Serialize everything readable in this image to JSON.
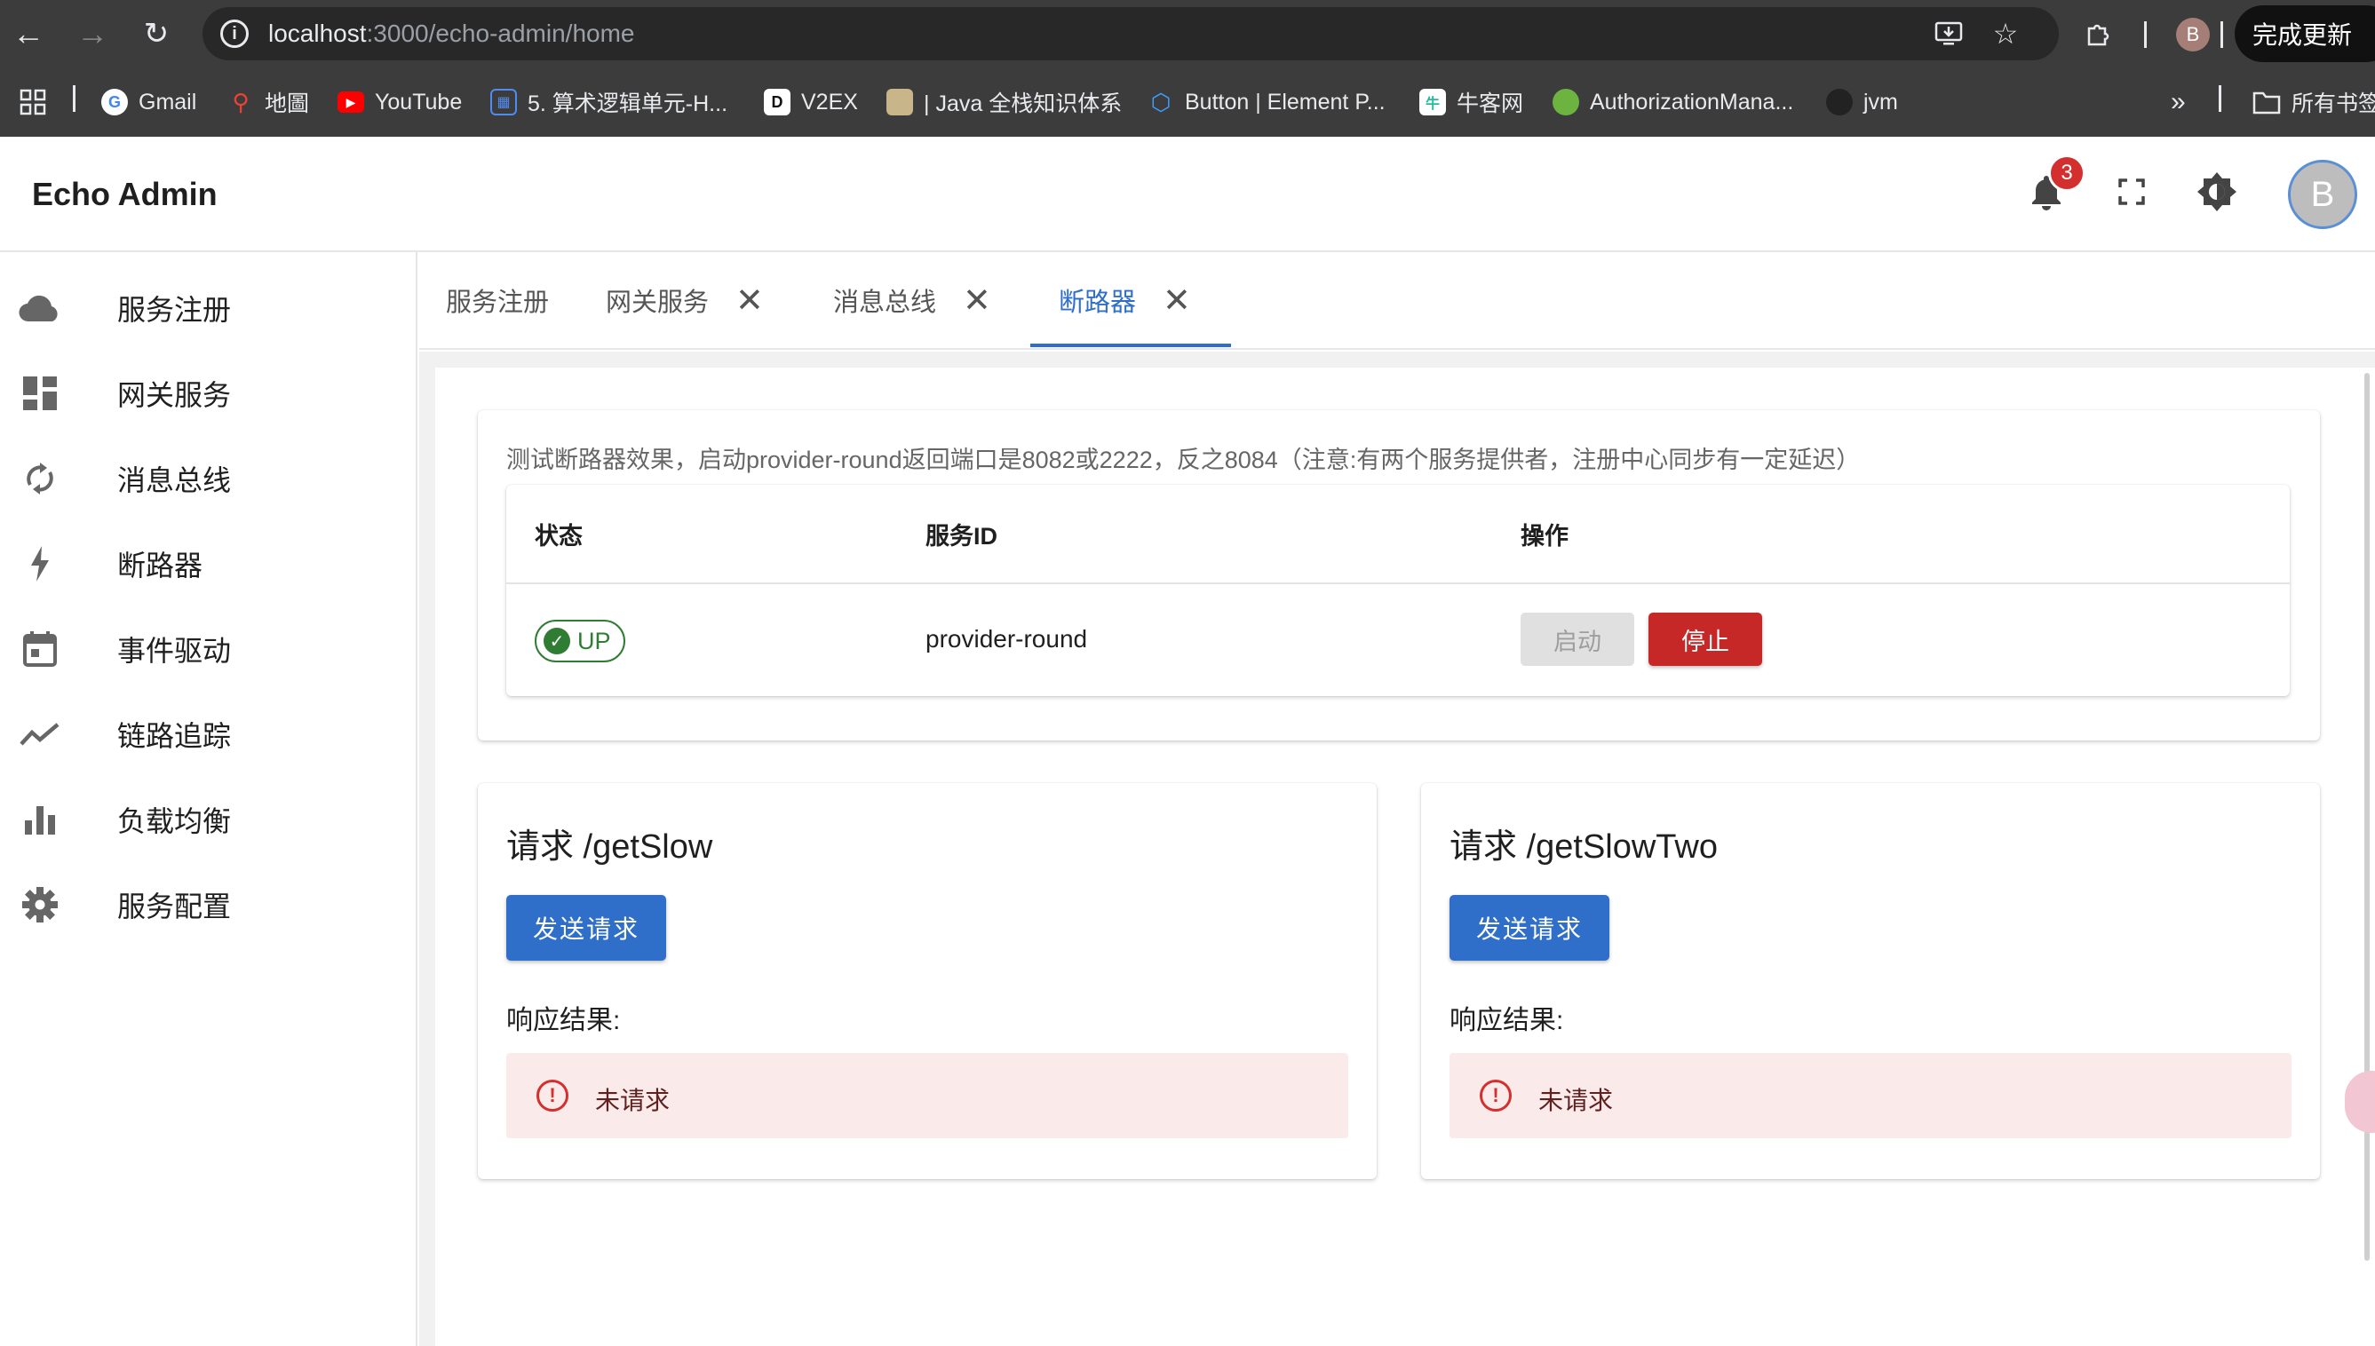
{
  "browser": {
    "url_host": "localhost",
    "url_rest": ":3000/echo-admin/home",
    "update_label": "完成更新",
    "profile_initial": "B",
    "all_bookmarks": "所有书签",
    "bookmarks": [
      {
        "label": "Gmail"
      },
      {
        "label": "地圖"
      },
      {
        "label": "YouTube"
      },
      {
        "label": "5. 算术逻辑单元-H..."
      },
      {
        "label": "V2EX"
      },
      {
        "label": "| Java 全栈知识体系"
      },
      {
        "label": "Button | Element P..."
      },
      {
        "label": "牛客网"
      },
      {
        "label": "AuthorizationMana..."
      },
      {
        "label": "jvm"
      }
    ]
  },
  "header": {
    "title": "Echo Admin",
    "notification_count": "3",
    "avatar_initial": "B"
  },
  "sidebar": {
    "items": [
      {
        "label": "服务注册",
        "icon": "cloud-icon"
      },
      {
        "label": "网关服务",
        "icon": "dashboard-icon"
      },
      {
        "label": "消息总线",
        "icon": "sync-icon"
      },
      {
        "label": "断路器",
        "icon": "lightning-icon"
      },
      {
        "label": "事件驱动",
        "icon": "calendar-icon"
      },
      {
        "label": "链路追踪",
        "icon": "trend-icon"
      },
      {
        "label": "负载均衡",
        "icon": "bar-chart-icon"
      },
      {
        "label": "服务配置",
        "icon": "gear-icon"
      }
    ]
  },
  "tabs": [
    {
      "label": "服务注册",
      "closable": false
    },
    {
      "label": "网关服务",
      "closable": true
    },
    {
      "label": "消息总线",
      "closable": true
    },
    {
      "label": "断路器",
      "closable": true,
      "active": true
    }
  ],
  "circuit": {
    "hint": "测试断路器效果，启动provider-round返回端口是8082或2222，反之8084（注意:有两个服务提供者，注册中心同步有一定延迟）",
    "columns": [
      "状态",
      "服务ID",
      "操作"
    ],
    "row": {
      "status": "UP",
      "service_id": "provider-round",
      "start_label": "启动",
      "stop_label": "停止"
    }
  },
  "requests": [
    {
      "title": "请求 /getSlow",
      "button": "发送请求",
      "result_label": "响应结果:",
      "result": "未请求"
    },
    {
      "title": "请求 /getSlowTwo",
      "button": "发送请求",
      "result_label": "响应结果:",
      "result": "未请求"
    }
  ],
  "colors": {
    "primary": "#2f6fc9",
    "danger": "#c62828",
    "success": "#2e7d32",
    "alert_bg": "#fbeaea"
  }
}
